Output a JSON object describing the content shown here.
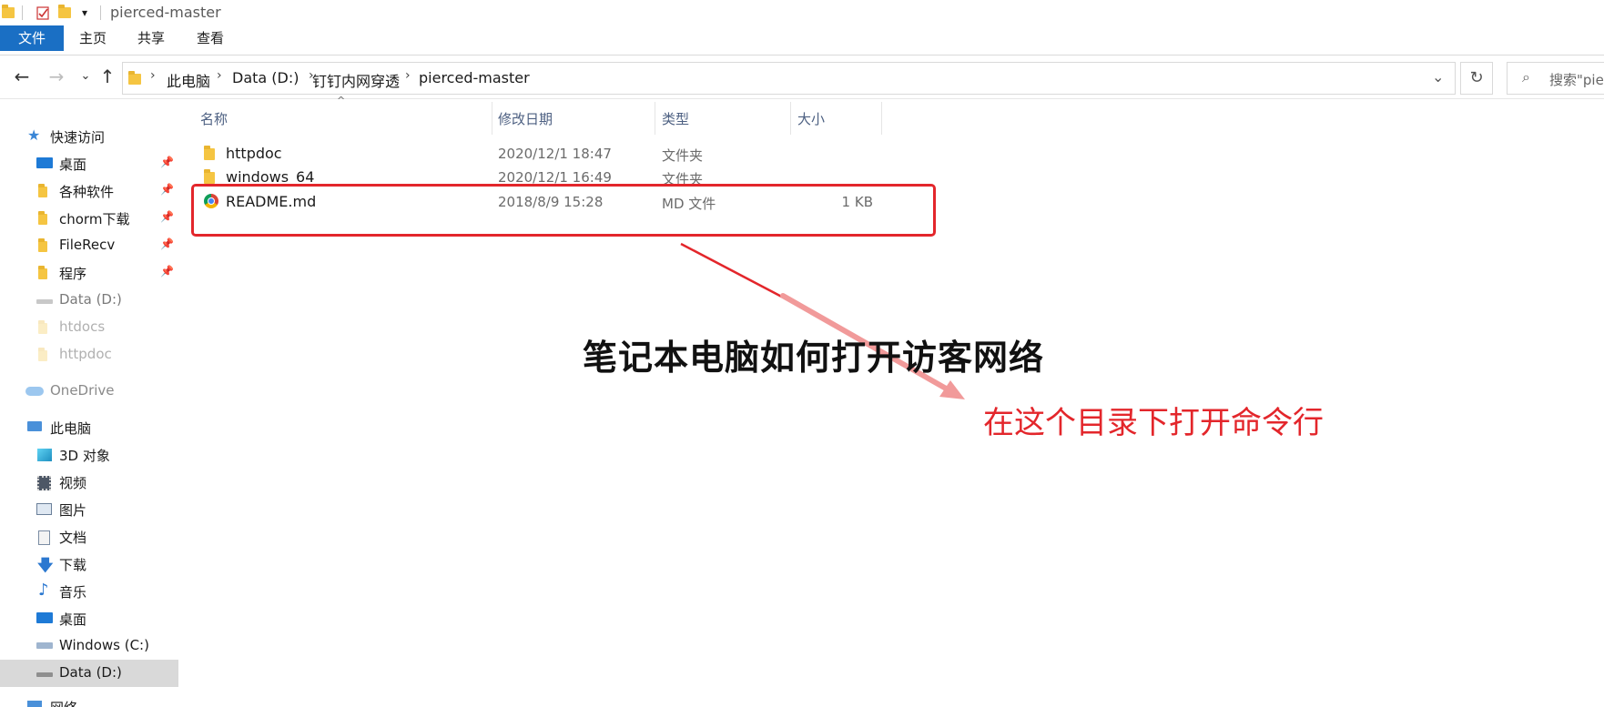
{
  "window": {
    "title": "pierced-master"
  },
  "ribbon": {
    "tabs": [
      "文件",
      "主页",
      "共享",
      "查看"
    ]
  },
  "address": {
    "breadcrumbs": [
      "此电脑",
      "Data (D:)",
      "钉钉内网穿透",
      "pierced-master"
    ],
    "search_placeholder": "搜索\"pie"
  },
  "sidebar": {
    "quick_access": "快速访问",
    "pinned": [
      "桌面",
      "各种软件",
      "chorm下载",
      "FileRecv",
      "程序"
    ],
    "recent": [
      "Data (D:)",
      "htdocs",
      "httpdoc"
    ],
    "onedrive": "OneDrive",
    "this_pc": "此电脑",
    "pc_items": [
      "3D 对象",
      "视频",
      "图片",
      "文档",
      "下载",
      "音乐",
      "桌面",
      "Windows (C:)",
      "Data (D:)"
    ],
    "network": "网络"
  },
  "columns": {
    "name": "名称",
    "date": "修改日期",
    "type": "类型",
    "size": "大小"
  },
  "files": [
    {
      "name": "httpdoc",
      "date": "2020/12/1 18:47",
      "type": "文件夹",
      "size": ""
    },
    {
      "name": "windows_64",
      "date": "2020/12/1 16:49",
      "type": "文件夹",
      "size": ""
    },
    {
      "name": "README.md",
      "date": "2018/8/9 15:28",
      "type": "MD 文件",
      "size": "1 KB"
    }
  ],
  "overlay": {
    "title": "笔记本电脑如何打开访客网络",
    "note": "在这个目录下打开命令行",
    "accent": "#e3262b"
  }
}
